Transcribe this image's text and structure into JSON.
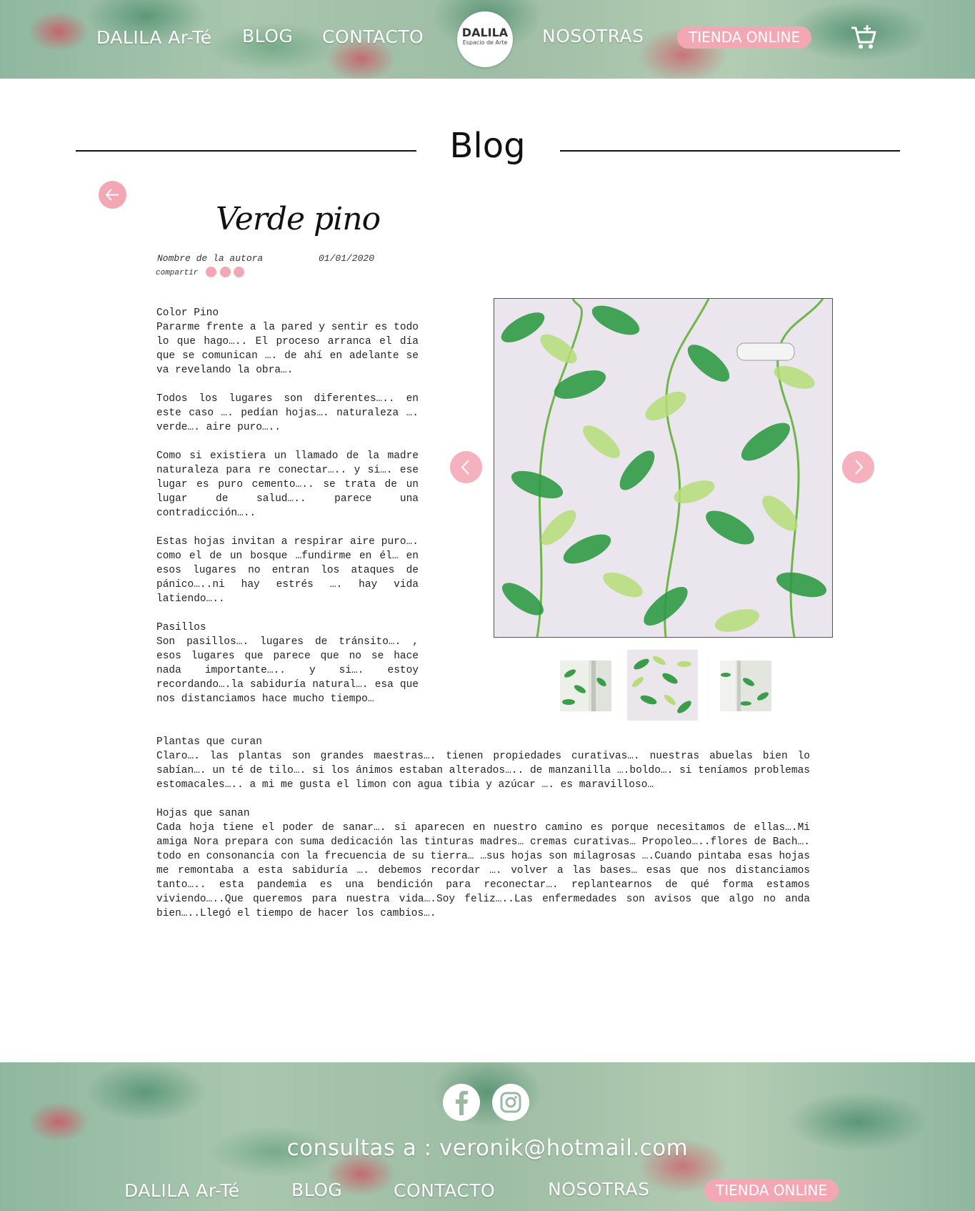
{
  "header": {
    "nav": [
      "DALILA Ar-Té",
      "BLOG",
      "CONTACTO",
      "NOSOTRAS"
    ],
    "shop_label": "TIENDA ONLINE",
    "logo_title": "DALILA",
    "logo_subtitle": "Espacio de Arte"
  },
  "page": {
    "title": "Blog"
  },
  "post": {
    "title": "Verde pino",
    "author": "Nombre de la autora",
    "date": "01/01/2020",
    "share_label": "compartir",
    "col_paragraphs": [
      "Color Pino\nPararme frente a la pared y sentir es todo lo que hago….. El proceso arranca el día que se comunican …. de ahí en adelante se va revelando la obra….",
      "Todos los lugares son diferentes….. en este caso …. pedían hojas…. naturaleza …. verde…. aire puro…..",
      "Como si existiera un llamado de la madre naturaleza para re conectar….. y si…. ese lugar es puro cemento….. se trata de un lugar de salud….. parece una contradicción…..",
      "Estas hojas invitan a respirar aire puro…. como el de un bosque …fundirme en él… en esos lugares no entran los ataques de pánico…..ni hay estrés …. hay vida latiendo…..",
      "Pasillos\nSon pasillos…. lugares de tránsito…. , esos lugares que parece que no se hace nada importante….. y si…. estoy recordando….la sabiduría natural…. esa que nos distanciamos hace mucho tiempo…"
    ],
    "full_paragraphs": [
      "Plantas que curan\nClaro…. las plantas son grandes maestras…. tienen propiedades curativas…. nuestras abuelas bien lo sabían…. un té de tilo…. si los ánimos estaban alterados….. de manzanilla ….boldo…. si teníamos problemas estomacales….. a mi me gusta el limon con agua tibia y azúcar …. es maravilloso…",
      "Hojas que sanan\nCada hoja tiene el poder de sanar…. si aparecen en nuestro camino es porque necesitamos de ellas….Mi amiga Nora prepara con suma dedicación las tinturas madres… cremas curativas… Propoleo…..flores de Bach…. todo en consonancia con la frecuencia de su tierra… …sus hojas son milagrosas ….Cuando pintaba esas hojas me remontaba a esta sabiduría …. debemos recordar …. volver a las bases… esas que nos distanciamos tanto….. esta pandemia es una bendición para reconectar…. replantearnos de qué forma estamos viviendo…..Que queremos para nuestra vida….Soy feliz…..Las enfermedades son avisos que algo no anda bien…..Llegó el tiempo de hacer los cambios…."
    ]
  },
  "footer": {
    "contact": "consultas a : veronik@hotmail.com",
    "nav": [
      "DALILA Ar-Té",
      "BLOG",
      "CONTACTO",
      "NOSOTRAS"
    ],
    "shop_label": "TIENDA ONLINE"
  },
  "colors": {
    "accent_pink": "#f3a6b4",
    "text": "#222222"
  }
}
